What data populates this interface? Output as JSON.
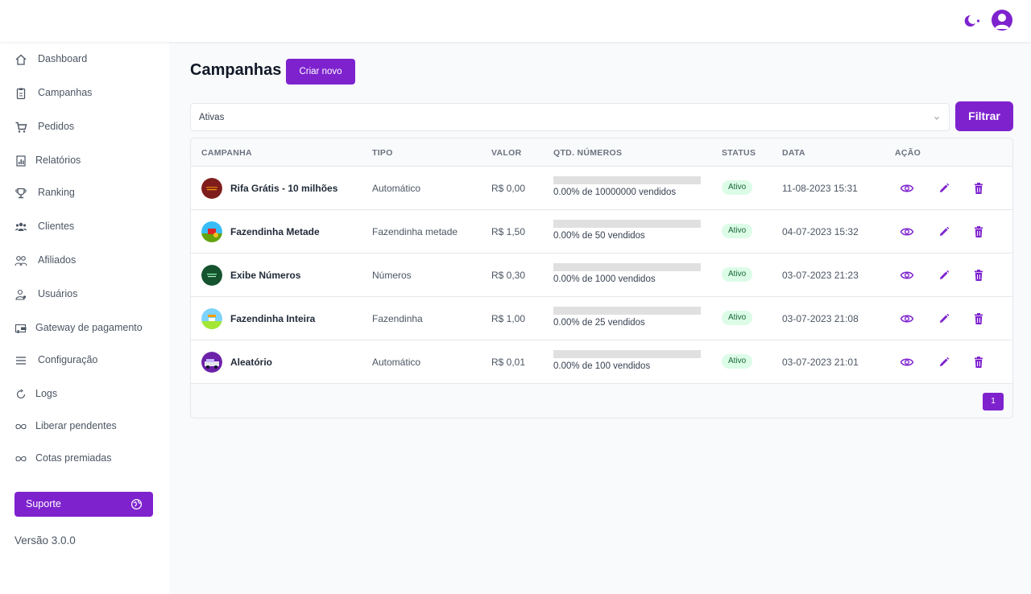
{
  "sidebar": {
    "items": [
      {
        "label": "Dashboard",
        "icon": "home-icon"
      },
      {
        "label": "Campanhas",
        "icon": "clipboard-icon"
      },
      {
        "label": "Pedidos",
        "icon": "cart-icon"
      },
      {
        "label": "Relatórios",
        "icon": "report-icon"
      },
      {
        "label": "Ranking",
        "icon": "trophy-icon"
      },
      {
        "label": "Clientes",
        "icon": "users-icon"
      },
      {
        "label": "Afiliados",
        "icon": "affiliates-icon"
      },
      {
        "label": "Usuários",
        "icon": "user-icon"
      },
      {
        "label": "Gateway de pagamento",
        "icon": "wallet-icon"
      },
      {
        "label": "Configuração",
        "icon": "menu-icon"
      },
      {
        "label": "Logs",
        "icon": "refresh-icon"
      },
      {
        "label": "Liberar pendentes",
        "icon": "infinity-icon"
      },
      {
        "label": "Cotas premiadas",
        "icon": "infinity-icon"
      }
    ],
    "support_label": "Suporte",
    "version": "Versão 3.0.0"
  },
  "main": {
    "title": "Campanhas",
    "create_label": "Criar novo",
    "filter_value": "Ativas",
    "filter_label": "Filtrar"
  },
  "table": {
    "headers": {
      "campanha": "CAMPANHA",
      "tipo": "TIPO",
      "valor": "VALOR",
      "qtd": "QTD. NÚMEROS",
      "status": "STATUS",
      "data": "DATA",
      "acao": "AÇÃO"
    },
    "rows": [
      {
        "name": "Rifa Grátis - 10 milhões",
        "tipo": "Automático",
        "valor": "R$ 0,00",
        "progress": 0.0,
        "qtd_text": "0.00% de 10000000 vendidos",
        "status": "Ativo",
        "data": "11-08-2023 15:31"
      },
      {
        "name": "Fazendinha Metade",
        "tipo": "Fazendinha metade",
        "valor": "R$ 1,50",
        "progress": 0.0,
        "qtd_text": "0.00% de 50 vendidos",
        "status": "Ativo",
        "data": "04-07-2023 15:32"
      },
      {
        "name": "Exibe Números",
        "tipo": "Números",
        "valor": "R$ 0,30",
        "progress": 0.0,
        "qtd_text": "0.00% de 1000 vendidos",
        "status": "Ativo",
        "data": "03-07-2023 21:23"
      },
      {
        "name": "Fazendinha Inteira",
        "tipo": "Fazendinha",
        "valor": "R$ 1,00",
        "progress": 0.0,
        "qtd_text": "0.00% de 25 vendidos",
        "status": "Ativo",
        "data": "03-07-2023 21:08"
      },
      {
        "name": "Aleatório",
        "tipo": "Automático",
        "valor": "R$ 0,01",
        "progress": 0.0,
        "qtd_text": "0.00% de 100 vendidos",
        "status": "Ativo",
        "data": "03-07-2023 21:01"
      }
    ],
    "page": "1"
  },
  "colors": {
    "accent": "#7e22ce",
    "badge_bg": "#dcfce7",
    "badge_text": "#166534"
  }
}
